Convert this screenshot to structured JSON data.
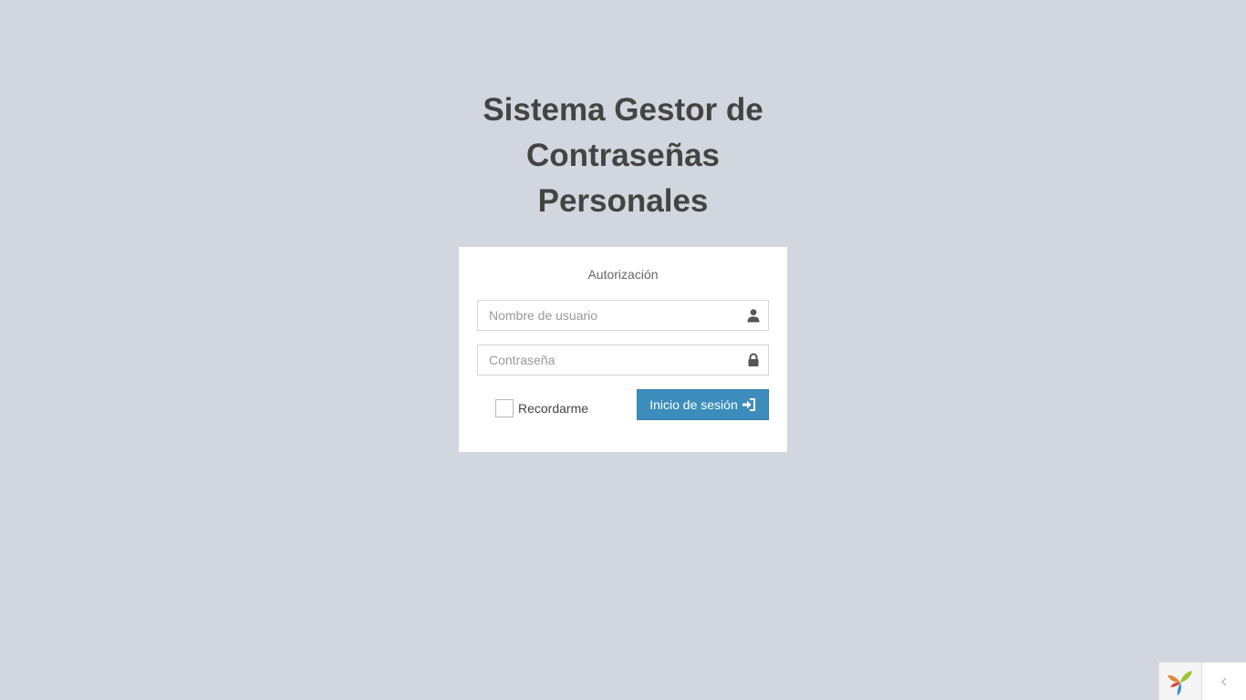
{
  "header": {
    "title_line1": "Sistema Gestor de",
    "title_line2": "Contraseñas",
    "title_line3": "Personales"
  },
  "login": {
    "box_message": "Autorización",
    "username": {
      "value": "",
      "placeholder": "Nombre de usuario",
      "icon": "user-icon"
    },
    "password": {
      "value": "",
      "placeholder": "Contraseña",
      "icon": "lock-icon"
    },
    "remember_label": "Recordarme",
    "remember_checked": false,
    "submit_label": "Inicio de sesión",
    "submit_icon": "log-in-icon"
  },
  "debug_toolbar": {
    "logo_icon": "yii-logo-icon",
    "toggle_icon": "chevron-left-icon"
  },
  "colors": {
    "background": "#d2d6de",
    "primary": "#3c8dbc",
    "title": "#444444"
  }
}
